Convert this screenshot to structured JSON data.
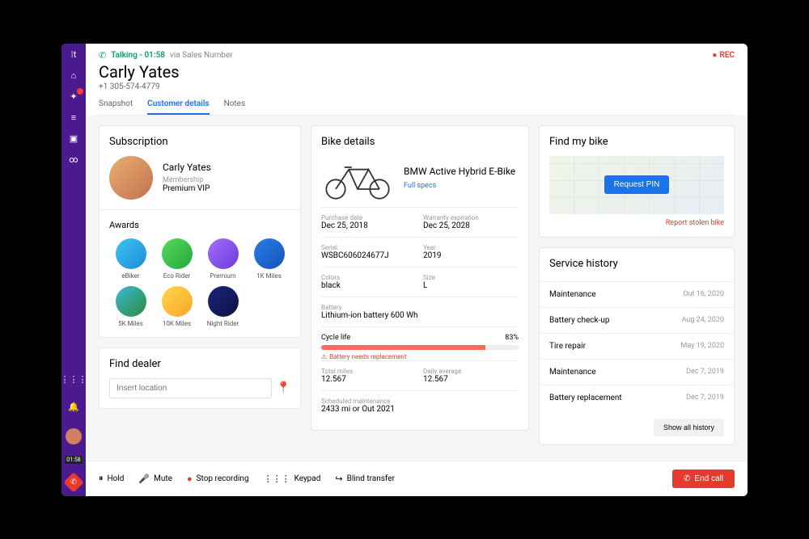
{
  "call": {
    "status": "Talking",
    "duration": "01:58",
    "via": "via Sales Number",
    "rec": "REC"
  },
  "customer": {
    "name": "Carly Yates",
    "phone": "+1 305-574-4779"
  },
  "tabs": [
    "Snapshot",
    "Customer details",
    "Notes"
  ],
  "subscription": {
    "title": "Subscription",
    "name": "Carly Yates",
    "membership_label": "Membership",
    "membership_value": "Premium VIP",
    "awards_title": "Awards",
    "awards": [
      "eBiker",
      "Eco Rider",
      "Premium",
      "1K Miles",
      "5K Miles",
      "10K Miles",
      "Night Rider"
    ]
  },
  "dealer": {
    "title": "Find dealer",
    "placeholder": "Insert location"
  },
  "bike": {
    "title": "Bike details",
    "name": "BMW Active Hybrid E-Bike",
    "specs_link": "Full specs",
    "purchase_label": "Purchase date",
    "purchase_value": "Dec 25, 2018",
    "warranty_label": "Warranty expiration",
    "warranty_value": "Dec 25, 2028",
    "serial_label": "Serial",
    "serial_value": "WSBC606024677J",
    "year_label": "Year",
    "year_value": "2019",
    "colors_label": "Colors",
    "colors_value": "black",
    "size_label": "Size",
    "size_value": "L",
    "battery_label": "Battery",
    "battery_value": "Lithium-ion battery 600 Wh",
    "cycle_label": "Cycle life",
    "cycle_pct": "83%",
    "cycle_warn": "Battery needs replacement",
    "miles_label": "Total miles",
    "miles_value": "12.567",
    "avg_label": "Daily average",
    "avg_value": "12.567",
    "maint_label": "Scheduled maintenance",
    "maint_value": "2433 mi or Out 2021"
  },
  "findbike": {
    "title": "Find my bike",
    "button": "Request PIN",
    "report": "Report stolen bike"
  },
  "service": {
    "title": "Service history",
    "rows": [
      {
        "name": "Maintenance",
        "date": "Out 16, 2020"
      },
      {
        "name": "Battery check-up",
        "date": "Aug 24, 2020"
      },
      {
        "name": "Tire repair",
        "date": "May 19, 2020"
      },
      {
        "name": "Maintenance",
        "date": "Dec 7, 2019"
      },
      {
        "name": "Battery replacement",
        "date": "Dec 7, 2019"
      }
    ],
    "show_all": "Show all history"
  },
  "controls": {
    "hold": "Hold",
    "mute": "Mute",
    "stop": "Stop recording",
    "keypad": "Keypad",
    "blind": "Blind transfer",
    "end": "End call"
  },
  "rail_timer": "01:58"
}
